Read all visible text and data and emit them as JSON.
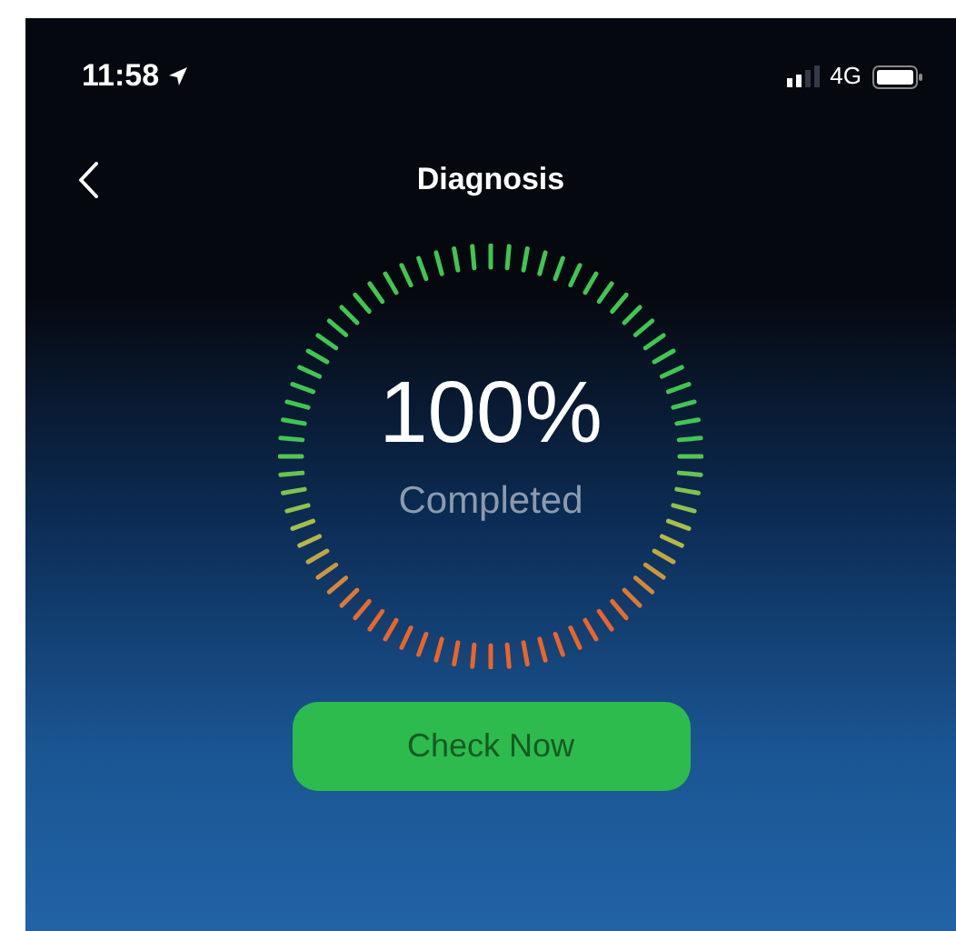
{
  "status_bar": {
    "time": "11:58",
    "network": "4G"
  },
  "nav": {
    "title": "Diagnosis"
  },
  "gauge": {
    "value": "100%",
    "caption": "Completed"
  },
  "button": {
    "label": "Check Now"
  }
}
